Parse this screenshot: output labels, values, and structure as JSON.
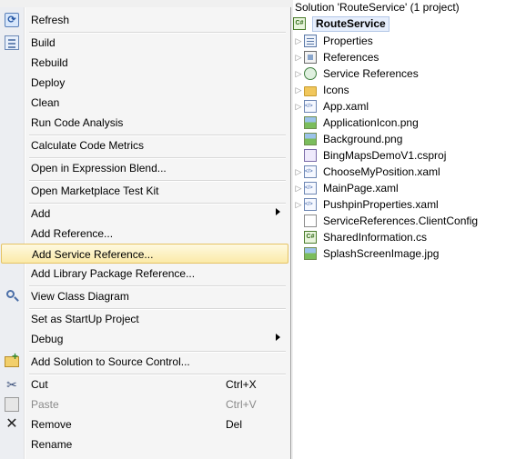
{
  "context_menu": {
    "items": [
      {
        "label": "Refresh",
        "icon": "refresh-icon"
      },
      {
        "label": "Build",
        "icon": "build-icon"
      },
      {
        "label": "Rebuild"
      },
      {
        "label": "Deploy"
      },
      {
        "label": "Clean"
      },
      {
        "label": "Run Code Analysis"
      },
      {
        "label": "Calculate Code Metrics"
      },
      {
        "label": "Open in Expression Blend..."
      },
      {
        "label": "Open Marketplace Test Kit"
      },
      {
        "label": "Add",
        "submenu": true
      },
      {
        "label": "Add Reference..."
      },
      {
        "label": "Add Service Reference...",
        "highlighted": true
      },
      {
        "label": "Add Library Package Reference..."
      },
      {
        "label": "View Class Diagram",
        "icon": "class-diagram-icon"
      },
      {
        "label": "Set as StartUp Project"
      },
      {
        "label": "Debug",
        "submenu": true
      },
      {
        "label": "Add Solution to Source Control...",
        "icon": "source-control-icon"
      },
      {
        "label": "Cut",
        "shortcut": "Ctrl+X",
        "icon": "scissors-icon"
      },
      {
        "label": "Paste",
        "shortcut": "Ctrl+V",
        "disabled": true,
        "icon": "paste-icon"
      },
      {
        "label": "Remove",
        "shortcut": "Del",
        "icon": "remove-icon"
      },
      {
        "label": "Rename"
      }
    ]
  },
  "solution_explorer": {
    "solution_label": "Solution 'RouteService' (1 project)",
    "project_label": "RouteService",
    "project_icon_text": "C#",
    "nodes": [
      {
        "label": "Properties",
        "icon": "properties-icon",
        "expandable": true
      },
      {
        "label": "References",
        "icon": "references-icon",
        "expandable": true
      },
      {
        "label": "Service References",
        "icon": "service-references-icon",
        "expandable": true
      },
      {
        "label": "Icons",
        "icon": "folder-icon",
        "expandable": false
      },
      {
        "label": "App.xaml",
        "icon": "xaml-file-icon",
        "expandable": true
      },
      {
        "label": "ApplicationIcon.png",
        "icon": "image-file-icon",
        "expandable": false
      },
      {
        "label": "Background.png",
        "icon": "image-file-icon",
        "expandable": false
      },
      {
        "label": "BingMapsDemoV1.csproj",
        "icon": "project-file-icon",
        "expandable": false
      },
      {
        "label": "ChooseMyPosition.xaml",
        "icon": "xaml-file-icon",
        "expandable": true
      },
      {
        "label": "MainPage.xaml",
        "icon": "xaml-file-icon",
        "expandable": true
      },
      {
        "label": "PushpinProperties.xaml",
        "icon": "xaml-file-icon",
        "expandable": true
      },
      {
        "label": "ServiceReferences.ClientConfig",
        "icon": "config-file-icon",
        "expandable": false
      },
      {
        "label": "SharedInformation.cs",
        "icon": "csharp-file-icon",
        "expandable": false
      },
      {
        "label": "SplashScreenImage.jpg",
        "icon": "image-file-icon",
        "expandable": false
      }
    ]
  }
}
